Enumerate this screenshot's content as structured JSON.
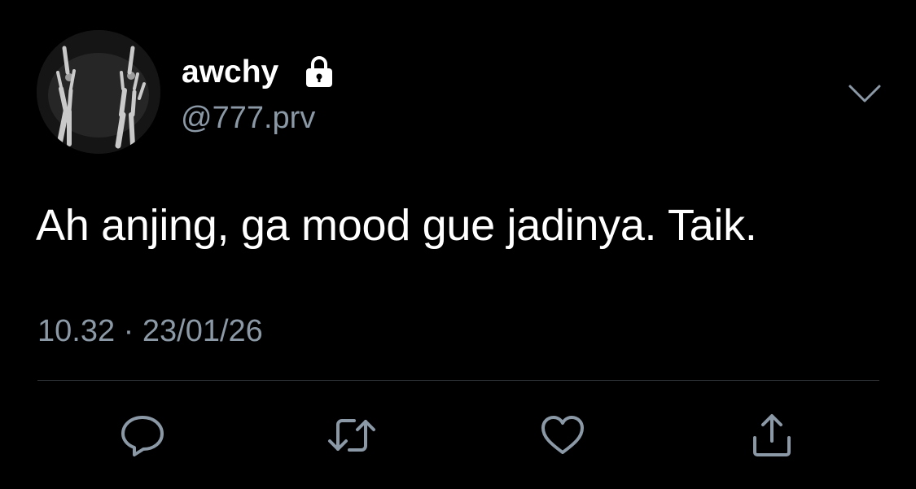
{
  "tweet": {
    "display_name": "awchy",
    "handle": "@777.prv",
    "text": "Ah anjing, ga mood gue jadinya. Taik.",
    "timestamp": "10.32 · 23/01/26",
    "protected": true
  },
  "icons": {
    "lock": "lock-icon",
    "menu": "chevron-down-icon",
    "reply": "reply-icon",
    "retweet": "retweet-icon",
    "like": "heart-icon",
    "share": "share-icon"
  },
  "colors": {
    "background": "#000000",
    "primary_text": "#ffffff",
    "secondary_text": "#8b98a5",
    "divider": "#2f3336"
  }
}
